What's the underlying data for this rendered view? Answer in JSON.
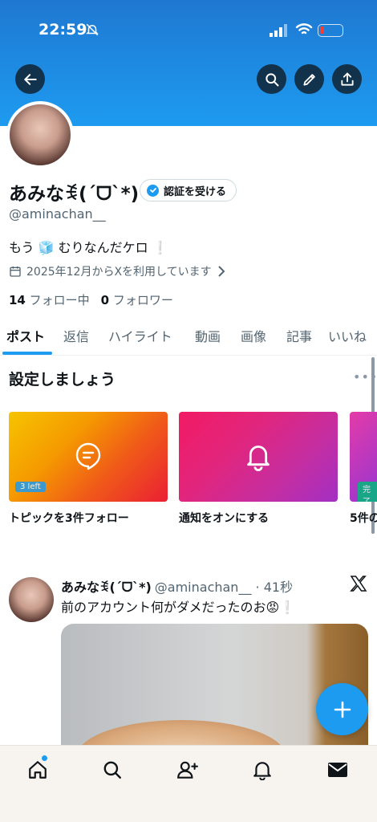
{
  "status_bar": {
    "time": "22:59"
  },
  "profile": {
    "display_name": "あみなꉂ(ˊᗜˋ*)",
    "verify_label": "認証を受ける",
    "handle": "@aminachan__",
    "bio": "もう 🧊 むりなんだケロ ❕",
    "joined": "2025年12月からXを利用しています",
    "following_count": "14",
    "following_label": "フォロー中",
    "followers_count": "0",
    "followers_label": "フォロワー"
  },
  "tabs": [
    "ポスト",
    "返信",
    "ハイライト",
    "動画",
    "画像",
    "記事",
    "いいね"
  ],
  "setup": {
    "title": "設定しましょう",
    "cards": [
      {
        "label": "トピックを3件フォロー",
        "badge": "3 left",
        "icon": "topic-bubble-icon"
      },
      {
        "label": "通知をオンにする",
        "icon": "bell-icon"
      },
      {
        "label": "5件の",
        "badge": "完了"
      }
    ]
  },
  "tweet": {
    "name": "あみなꉂ(ˊᗜˋ*)",
    "handle_time": "@aminachan__ · 41秒",
    "text": "前のアカウント何がダメだったのお😡❕"
  },
  "colors": {
    "accent": "#1d9bf0",
    "banner": "#1d9bf0"
  },
  "icons": {
    "back": "back-arrow-icon",
    "search": "search-icon",
    "edit": "edit-pen-icon",
    "share": "share-icon",
    "compose": "plus-icon",
    "nav": [
      "home-icon",
      "search-icon",
      "add-user-icon",
      "bell-icon",
      "mail-icon"
    ]
  }
}
